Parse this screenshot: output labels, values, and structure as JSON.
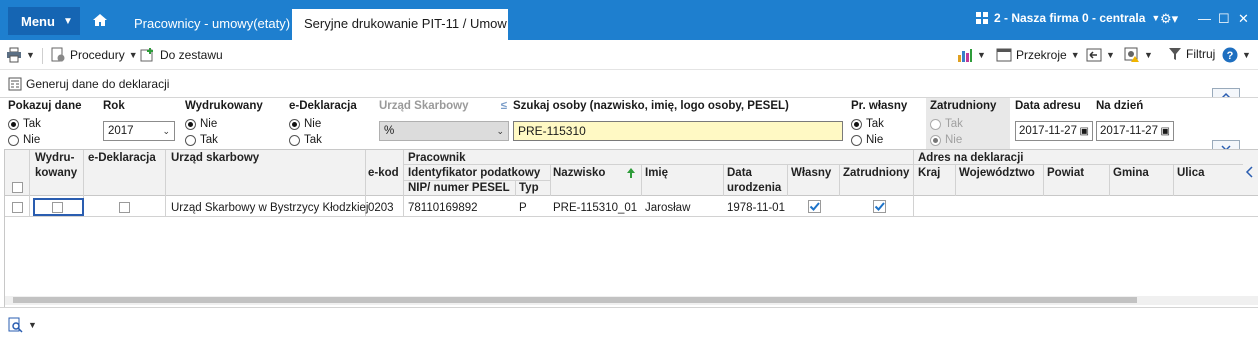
{
  "titlebar": {
    "menu_label": "Menu",
    "tabs": [
      {
        "label": "Pracownicy - umowy(etaty)"
      },
      {
        "label": "Seryjne drukowanie PIT-11 / Umow"
      }
    ],
    "company": "2 - Nasza firma 0 - centrala",
    "accent": "#1e7fcf"
  },
  "toolbar": {
    "procedures_label": "Procedury",
    "add_to_set_label": "Do zestawu",
    "cross_sections_label": "Przekroje",
    "filter_label": "Filtruj"
  },
  "generate_label": "Generuj dane do deklaracji",
  "filters": {
    "show_data": {
      "label": "Pokazuj dane",
      "options": [
        "Tak",
        "Nie"
      ],
      "selected": 0
    },
    "year": {
      "label": "Rok",
      "value": "2017"
    },
    "printed": {
      "label": "Wydrukowany",
      "options": [
        "Nie",
        "Tak"
      ],
      "selected": 0
    },
    "edeclaration": {
      "label": "e-Deklaracja",
      "options": [
        "Nie",
        "Tak"
      ],
      "selected": 0
    },
    "tax_office": {
      "label": "Urząd Skarbowy",
      "value": "%"
    },
    "search": {
      "label": "Szukaj osoby (nazwisko, imię, logo osoby, PESEL)",
      "value": "PRE-115310"
    },
    "own_employee": {
      "label": "Pr. własny",
      "options": [
        "Tak",
        "Nie"
      ],
      "selected": 0
    },
    "employed": {
      "label": "Zatrudniony",
      "options": [
        "Tak",
        "Nie"
      ],
      "selected": 1
    },
    "address_date": {
      "label": "Data adresu",
      "value": "2017-11-27"
    },
    "as_of_date": {
      "label": "Na dzień",
      "value": "2017-11-27"
    }
  },
  "grid": {
    "headers": {
      "printed_1": "Wydru-",
      "printed_2": "kowany",
      "edecl": "e-Deklaracja",
      "office": "Urząd skarbowy",
      "ekod": "e-kod",
      "employee_group": "Pracownik",
      "tax_id": "Identyfikator podatkowy",
      "nip": "NIP/ numer PESEL",
      "type": "Typ",
      "surname": "Nazwisko",
      "name": "Imię",
      "birth_1": "Data",
      "birth_2": "urodzenia",
      "own": "Własny",
      "employed": "Zatrudniony",
      "address_group": "Adres na deklaracji",
      "country": "Kraj",
      "voivodeship": "Województwo",
      "county": "Powiat",
      "commune": "Gmina",
      "street": "Ulica"
    },
    "rows": [
      {
        "office": "Urząd Skarbowy w Bystrzycy Kłodzkiej",
        "ekod": "0203",
        "nip": "78110169892",
        "type": "P",
        "surname": "PRE-115310_01",
        "name": "Jarosław",
        "birth": "1978-11-01"
      }
    ]
  }
}
